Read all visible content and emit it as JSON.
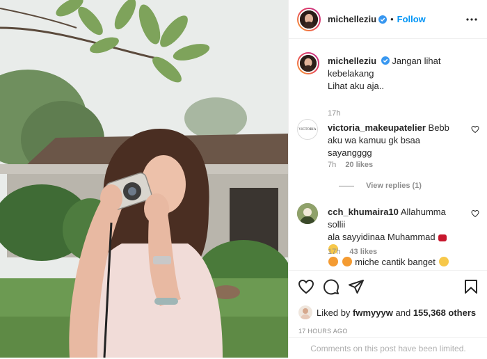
{
  "post": {
    "username": "michelleziu",
    "follow_label": "Follow",
    "dot": "•",
    "caption_lines": [
      "Jangan lihat",
      "kebelakang",
      "Lihat aku aja.."
    ],
    "caption_time": "17h"
  },
  "comments": [
    {
      "username": "victoria_makeupatelier",
      "text_lines": [
        "Bebb",
        "aku wa kamuu gk bsaa",
        "sayangggg"
      ],
      "time": "7h",
      "likes": "20 likes",
      "view_replies": "View replies (1)",
      "avatar_label": "VICTORIA"
    },
    {
      "username": "cch_khumaira10",
      "text_line1": "Allahumma sollii",
      "text_line2": "ala sayyidinaa Muhammad",
      "text_line3": "miche cantik banget",
      "time": "17h",
      "likes": "43 likes"
    }
  ],
  "footer": {
    "liked_prefix": "Liked by",
    "liked_user": "fwmyyyw",
    "liked_and": "and",
    "liked_count": "155,368 others",
    "time_ago": "17 HOURS AGO",
    "limited_text": "Comments on this post have been limited."
  },
  "colors": {
    "accent": "#0095f6",
    "muted": "#8e8e8e",
    "text": "#262626"
  },
  "icons": [
    "more-options-icon",
    "verified-icon",
    "heart-icon",
    "comment-icon",
    "share-icon",
    "bookmark-icon"
  ]
}
